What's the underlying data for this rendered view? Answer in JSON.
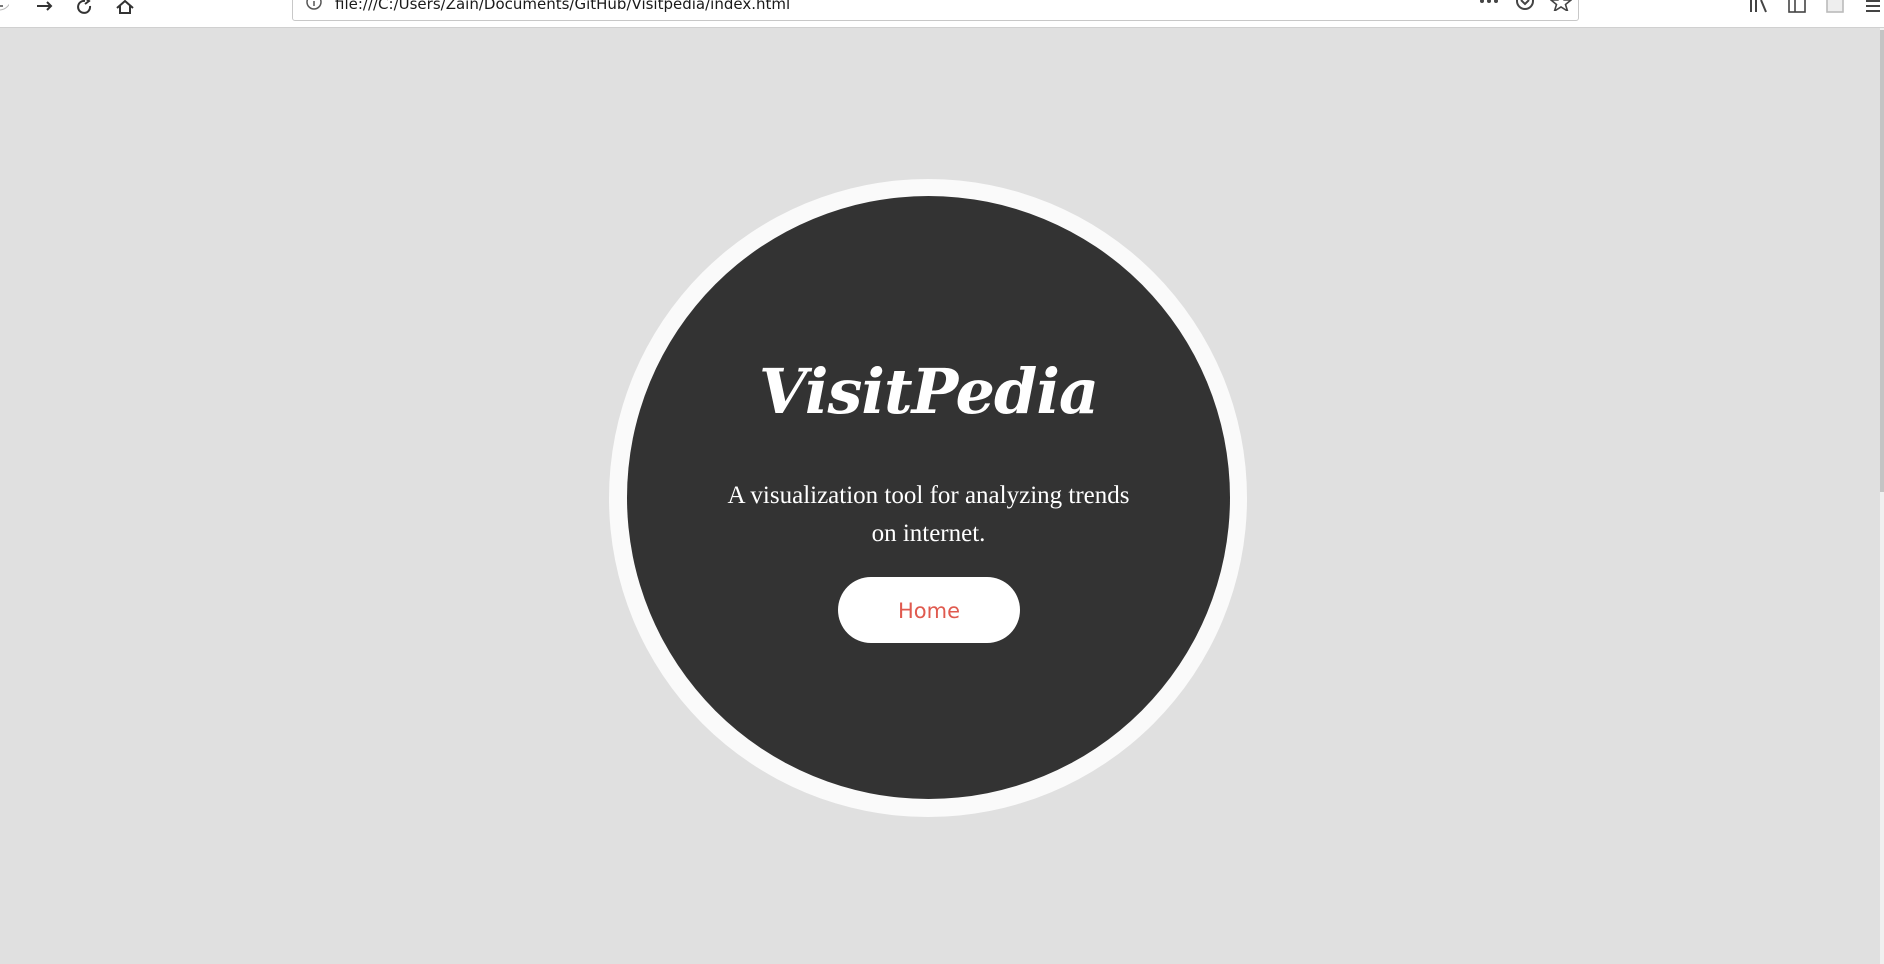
{
  "browser": {
    "url": "file:///C:/Users/Zain/Documents/GitHub/Visitpedia/index.html",
    "icons": {
      "back": "back-arrow-icon",
      "forward": "forward-arrow-icon",
      "reload": "reload-icon",
      "home": "home-icon",
      "info": "info-icon",
      "more": "more-actions-icon",
      "pocket": "pocket-icon",
      "bookmark": "bookmark-star-icon",
      "library": "library-icon",
      "sidebar": "sidebar-icon",
      "extension": "extension-icon",
      "menu": "hamburger-menu-icon"
    }
  },
  "hero": {
    "title": "VisitPedia",
    "description": "A visualization tool for analyzing trends on internet.",
    "button_label": "Home"
  },
  "colors": {
    "background": "#e0e0e0",
    "circle": "#333333",
    "ring": "#fafafa",
    "button_text": "#e05a4f"
  }
}
